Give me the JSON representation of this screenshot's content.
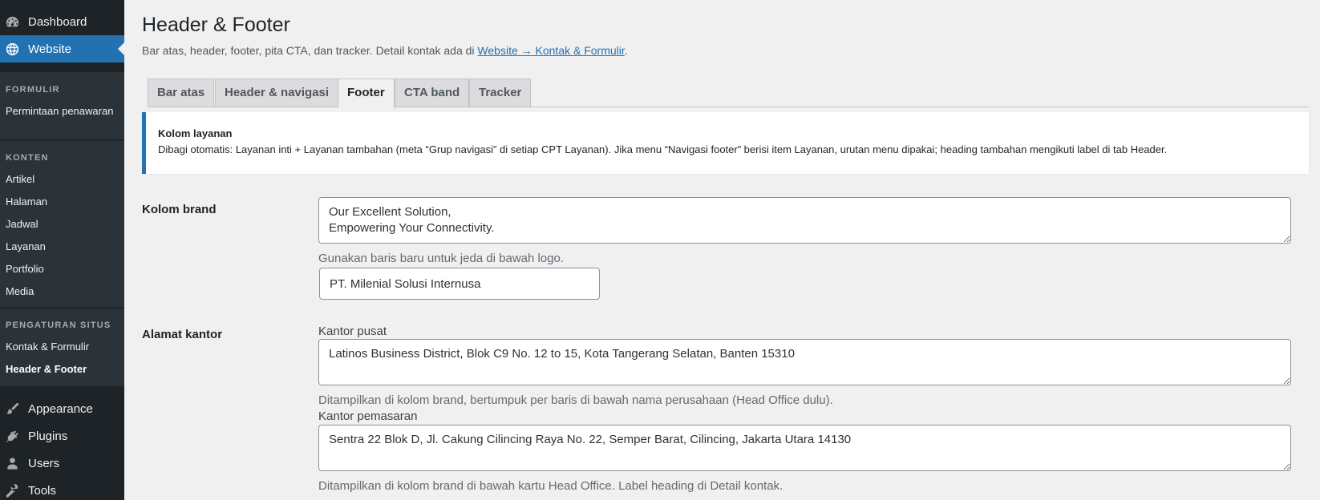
{
  "sidebar": {
    "top": [
      {
        "label": "Dashboard",
        "icon": "dashboard-icon"
      },
      {
        "label": "Website",
        "icon": "globe-icon",
        "current": true
      }
    ],
    "sections": [
      {
        "heading": "FORMULIR",
        "items": [
          "Permintaan penawaran"
        ]
      },
      {
        "heading": "KONTEN",
        "items": [
          "Artikel",
          "Halaman",
          "Jadwal",
          "Layanan",
          "Portfolio",
          "Media"
        ]
      },
      {
        "heading": "PENGATURAN SITUS",
        "items": [
          "Kontak & Formulir",
          "Header & Footer"
        ]
      }
    ],
    "bottom": [
      {
        "label": "Appearance",
        "icon": "paintbrush-icon"
      },
      {
        "label": "Plugins",
        "icon": "plug-icon"
      },
      {
        "label": "Users",
        "icon": "user-icon"
      },
      {
        "label": "Tools",
        "icon": "wrench-icon"
      }
    ]
  },
  "page": {
    "title": "Header & Footer",
    "lead_text": "Bar atas, header, footer, pita CTA, dan tracker. Detail kontak ada di ",
    "lead_link": "Website → Kontak & Formulir",
    "lead_end": "."
  },
  "tabs": [
    "Bar atas",
    "Header & navigasi",
    "Footer",
    "CTA band",
    "Tracker"
  ],
  "active_tab": "Footer",
  "notice": {
    "title": "Kolom layanan",
    "body": "Dibagi otomatis: Layanan inti + Layanan tambahan (meta “Grup navigasi” di setiap CPT Layanan). Jika menu “Navigasi footer” berisi item Layanan, urutan menu dipakai; heading tambahan mengikuti label di tab Header."
  },
  "brand": {
    "label": "Kolom brand",
    "tagline_value": "Our Excellent Solution,\nEmpowering Your Connectivity.",
    "tagline_desc": "Gunakan baris baru untuk jeda di bawah logo.",
    "company_value": "PT. Milenial Solusi Internusa"
  },
  "address": {
    "label": "Alamat kantor",
    "head_label": "Kantor pusat",
    "head_value": "Latinos Business District, Blok C9 No. 12 to 15, Kota Tangerang Selatan, Banten 15310",
    "head_desc": "Ditampilkan di kolom brand, bertumpuk per baris di bawah nama perusahaan (Head Office dulu).",
    "marketing_label": "Kantor pemasaran",
    "marketing_value": "Sentra 22 Blok D, Jl. Cakung Cilincing Raya No. 22, Semper Barat, Cilincing, Jakarta Utara 14130",
    "marketing_desc": "Ditampilkan di kolom brand di bawah kartu Head Office. Label heading di Detail kontak."
  }
}
